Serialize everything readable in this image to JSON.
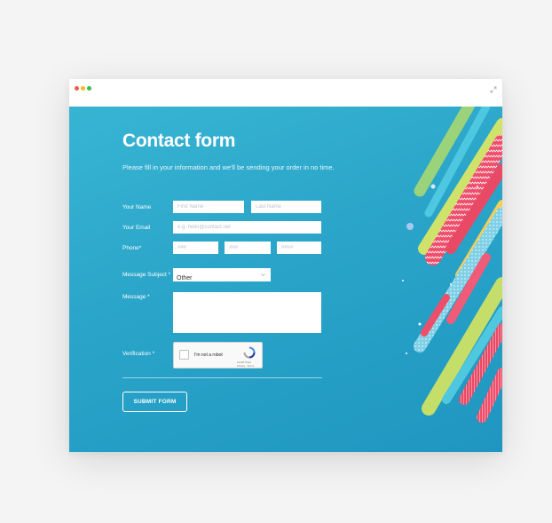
{
  "form": {
    "title": "Contact form",
    "subtitle": "Please fill in your information and we'll be sending your order in no time.",
    "name_label": "Your Name",
    "first_name_placeholder": "First Name",
    "last_name_placeholder": "Last Name",
    "email_label": "Your Email",
    "email_placeholder": "e.g. hello@contact.net",
    "phone_label": "Phone*",
    "phone_area_placeholder": "###",
    "phone_prefix_placeholder": "###",
    "phone_line_placeholder": "####",
    "subject_label": "Message Subject *",
    "subject_value": "Other",
    "message_label": "Message *",
    "verification_label": "Verification *",
    "captcha_text": "I'm not a robot",
    "captcha_brand": "reCAPTCHA",
    "captcha_terms": "Privacy - Terms",
    "submit_label": "SUBMIT FORM"
  },
  "icons": {
    "window_controls": [
      "close-dot",
      "minimize-dot",
      "maximize-dot"
    ],
    "expand": "expand-icon",
    "select_chevron": "chevron-down-icon",
    "captcha": "recaptcha-icon"
  },
  "colors": {
    "background_start": "#38b4d3",
    "background_end": "#1f96c0",
    "close": "#f05a4a",
    "minimize": "#f5b82e",
    "maximize": "#34c24a"
  }
}
